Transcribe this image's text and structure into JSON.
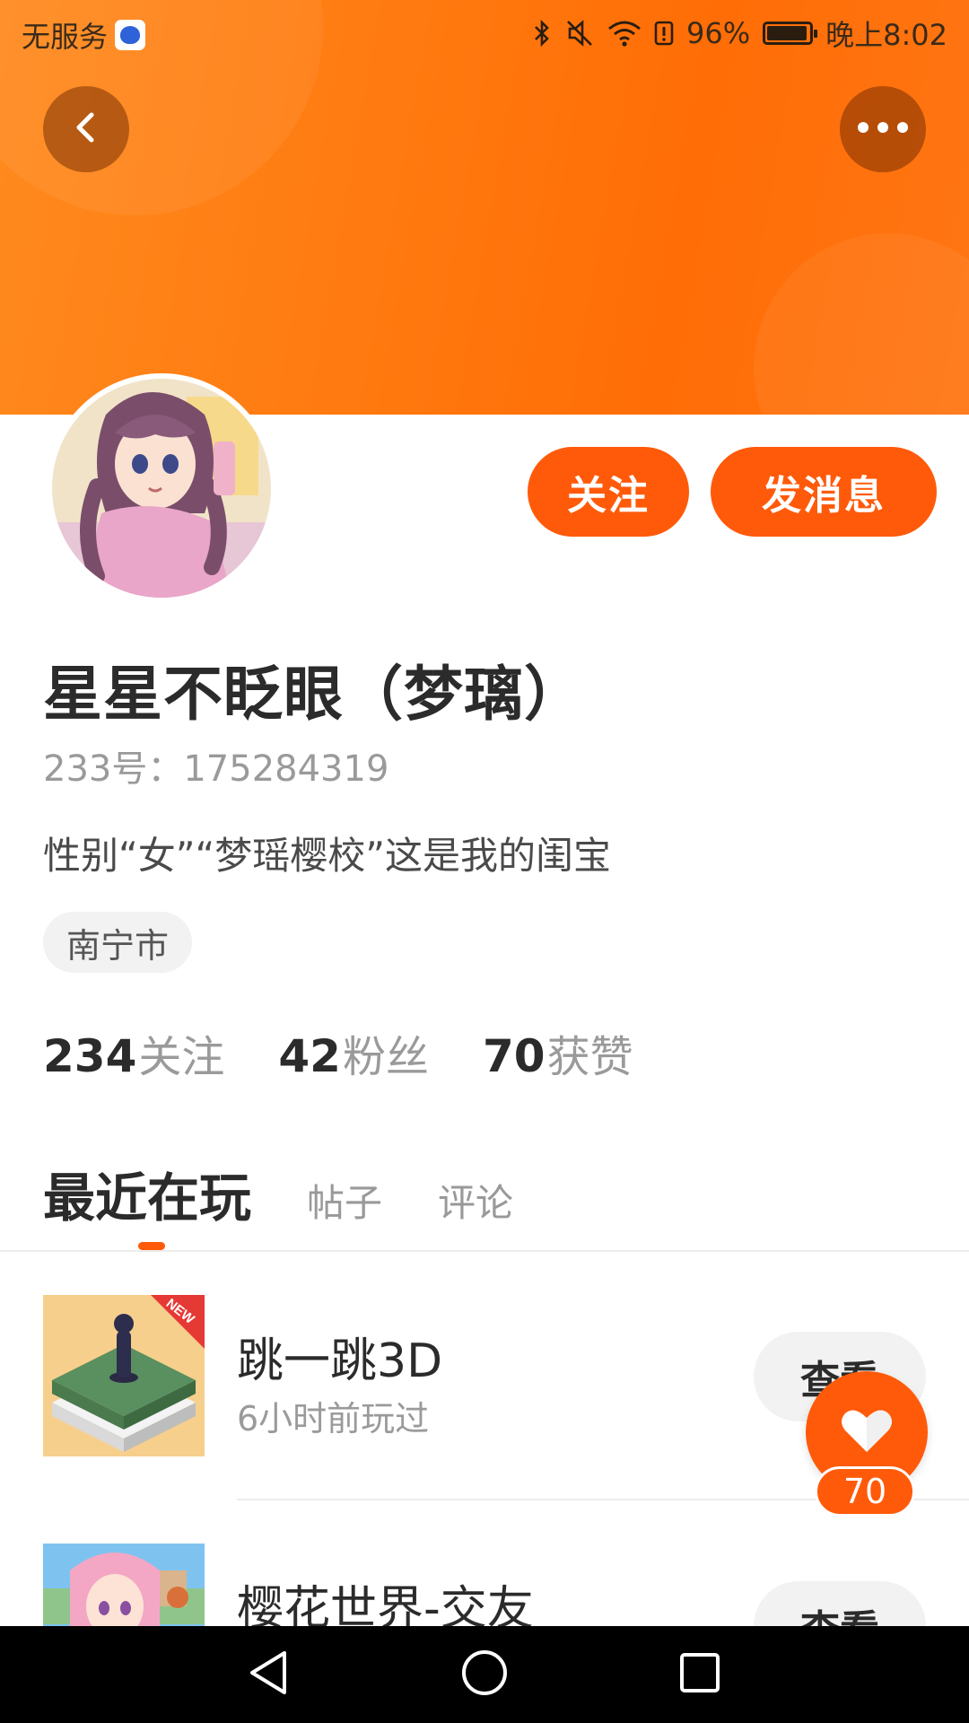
{
  "status_bar": {
    "carrier": "无服务",
    "battery": "96%",
    "time": "晚上8:02",
    "battery_level": 0.96,
    "icons": [
      "bluetooth-icon",
      "mute-icon",
      "wifi-icon",
      "alert-icon",
      "battery-icon"
    ]
  },
  "header": {
    "back_icon": "chevron-left-icon",
    "more_icon": "more-dots-icon"
  },
  "profile": {
    "follow_label": "关注",
    "message_label": "发消息",
    "name": "星星不眨眼（梦璃）",
    "id_line": "233号：175284319",
    "bio": "性别“女”“梦瑶樱校”这是我的闺宝",
    "city": "南宁市"
  },
  "stats": [
    {
      "num": "234",
      "label": "关注"
    },
    {
      "num": "42",
      "label": "粉丝"
    },
    {
      "num": "70",
      "label": "获赞"
    }
  ],
  "tabs": [
    "最近在玩",
    "帖子",
    "评论"
  ],
  "games": [
    {
      "title": "跳一跳3D",
      "subtitle": "6小时前玩过",
      "view_label": "查看",
      "badge": "NEW"
    },
    {
      "title": "樱花世界-交友",
      "subtitle": "",
      "view_label": "查看"
    }
  ],
  "fab": {
    "count": "70"
  },
  "colors": {
    "accent": "#ff5a0a",
    "banner": "#ff7a10"
  }
}
